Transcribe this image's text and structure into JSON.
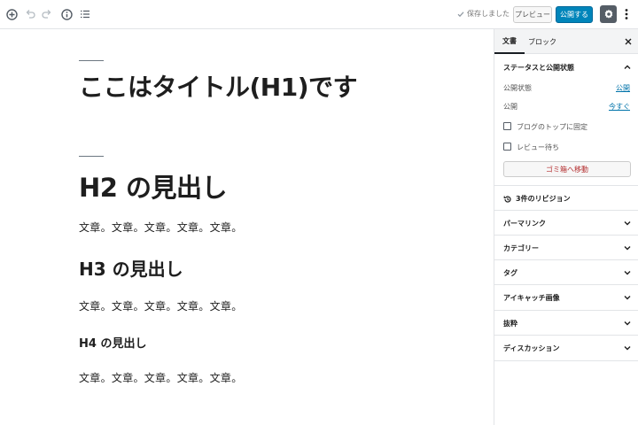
{
  "toolbar": {
    "saved_text": "保存しました",
    "preview_label": "プレビュー",
    "publish_label": "公開する"
  },
  "editor": {
    "title": "ここはタイトル(H1)です",
    "h2": "H2 の見出し",
    "p1": "文章。文章。文章。文章。文章。",
    "h3": "H3 の見出し",
    "p2": "文章。文章。文章。文章。文章。",
    "h4": "H4 の見出し",
    "p3": "文章。文章。文章。文章。文章。"
  },
  "sidebar": {
    "tabs": [
      {
        "label": "文書"
      },
      {
        "label": "ブロック"
      }
    ],
    "status_panel": {
      "title": "ステータスと公開状態",
      "visibility_label": "公開状態",
      "visibility_value": "公開",
      "publish_label": "公開",
      "publish_value": "今すぐ",
      "sticky_label": "ブログのトップに固定",
      "pending_label": "レビュー待ち",
      "trash_label": "ゴミ箱へ移動"
    },
    "revisions_label": "3件のリビジョン",
    "panels": [
      {
        "label": "パーマリンク"
      },
      {
        "label": "カテゴリー"
      },
      {
        "label": "タグ"
      },
      {
        "label": "アイキャッチ画像"
      },
      {
        "label": "抜粋"
      },
      {
        "label": "ディスカッション"
      }
    ]
  },
  "colors": {
    "accent": "#0085ba",
    "link": "#0073aa",
    "danger": "#b32d2e"
  }
}
